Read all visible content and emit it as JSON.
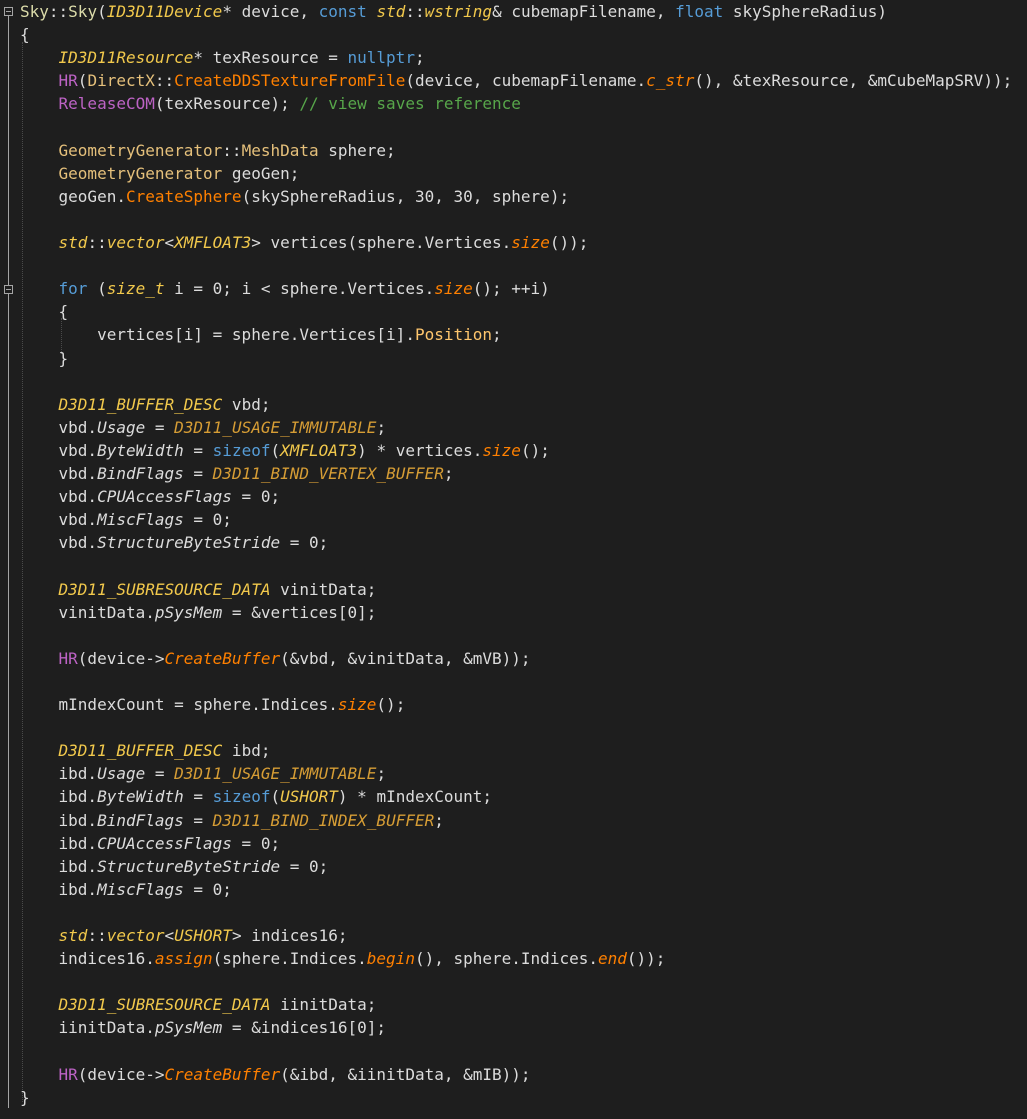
{
  "editor": {
    "lines": [
      [
        [
          "fn",
          "Sky"
        ],
        [
          "default",
          "::"
        ],
        [
          "fn",
          "Sky"
        ],
        [
          "default",
          "("
        ],
        [
          "type",
          "ID3D11Device"
        ],
        [
          "default",
          "* device, "
        ],
        [
          "keyword",
          "const"
        ],
        [
          "default",
          " "
        ],
        [
          "type",
          "std"
        ],
        [
          "default",
          "::"
        ],
        [
          "type",
          "wstring"
        ],
        [
          "default",
          "& cubemapFilename, "
        ],
        [
          "keyword",
          "float"
        ],
        [
          "default",
          " skySphereRadius)"
        ]
      ],
      [
        [
          "default",
          "{"
        ]
      ],
      [
        [
          "default",
          "    "
        ],
        [
          "type",
          "ID3D11Resource"
        ],
        [
          "default",
          "* texResource = "
        ],
        [
          "keyword",
          "nullptr"
        ],
        [
          "default",
          ";"
        ]
      ],
      [
        [
          "default",
          "    "
        ],
        [
          "macro",
          "HR"
        ],
        [
          "default",
          "("
        ],
        [
          "class",
          "DirectX"
        ],
        [
          "default",
          "::"
        ],
        [
          "method",
          "CreateDDSTextureFromFile"
        ],
        [
          "default",
          "(device, cubemapFilename."
        ],
        [
          "method-i",
          "c_str"
        ],
        [
          "default",
          "(), &texResource, &mCubeMapSRV));"
        ]
      ],
      [
        [
          "default",
          "    "
        ],
        [
          "macro",
          "ReleaseCOM"
        ],
        [
          "default",
          "(texResource); "
        ],
        [
          "comment",
          "// view saves reference"
        ]
      ],
      [
        [
          "default",
          ""
        ]
      ],
      [
        [
          "default",
          "    "
        ],
        [
          "class",
          "GeometryGenerator"
        ],
        [
          "default",
          "::"
        ],
        [
          "class",
          "MeshData"
        ],
        [
          "default",
          " sphere;"
        ]
      ],
      [
        [
          "default",
          "    "
        ],
        [
          "class",
          "GeometryGenerator"
        ],
        [
          "default",
          " geoGen;"
        ]
      ],
      [
        [
          "default",
          "    geoGen."
        ],
        [
          "method",
          "CreateSphere"
        ],
        [
          "default",
          "(skySphereRadius, 30, 30, sphere);"
        ]
      ],
      [
        [
          "default",
          ""
        ]
      ],
      [
        [
          "default",
          "    "
        ],
        [
          "type",
          "std"
        ],
        [
          "default",
          "::"
        ],
        [
          "type",
          "vector"
        ],
        [
          "default",
          "<"
        ],
        [
          "type",
          "XMFLOAT3"
        ],
        [
          "default",
          "> vertices(sphere.Vertices."
        ],
        [
          "method-i",
          "size"
        ],
        [
          "default",
          "());"
        ]
      ],
      [
        [
          "default",
          ""
        ]
      ],
      [
        [
          "default",
          "    "
        ],
        [
          "keyword",
          "for"
        ],
        [
          "default",
          " ("
        ],
        [
          "type",
          "size_t"
        ],
        [
          "default",
          " i = 0; i < sphere.Vertices."
        ],
        [
          "method-i",
          "size"
        ],
        [
          "default",
          "(); ++i)"
        ]
      ],
      [
        [
          "default",
          "    {"
        ]
      ],
      [
        [
          "default",
          "        vertices[i] = sphere.Vertices[i]."
        ],
        [
          "prop",
          "Position"
        ],
        [
          "default",
          ";"
        ]
      ],
      [
        [
          "default",
          "    }"
        ]
      ],
      [
        [
          "default",
          ""
        ]
      ],
      [
        [
          "default",
          "    "
        ],
        [
          "type",
          "D3D11_BUFFER_DESC"
        ],
        [
          "default",
          " vbd;"
        ]
      ],
      [
        [
          "default",
          "    vbd."
        ],
        [
          "member",
          "Usage"
        ],
        [
          "default",
          " = "
        ],
        [
          "enumv",
          "D3D11_USAGE_IMMUTABLE"
        ],
        [
          "default",
          ";"
        ]
      ],
      [
        [
          "default",
          "    vbd."
        ],
        [
          "member",
          "ByteWidth"
        ],
        [
          "default",
          " = "
        ],
        [
          "keyword",
          "sizeof"
        ],
        [
          "default",
          "("
        ],
        [
          "type",
          "XMFLOAT3"
        ],
        [
          "default",
          ") * vertices."
        ],
        [
          "method-i",
          "size"
        ],
        [
          "default",
          "();"
        ]
      ],
      [
        [
          "default",
          "    vbd."
        ],
        [
          "member",
          "BindFlags"
        ],
        [
          "default",
          " = "
        ],
        [
          "enumv",
          "D3D11_BIND_VERTEX_BUFFER"
        ],
        [
          "default",
          ";"
        ]
      ],
      [
        [
          "default",
          "    vbd."
        ],
        [
          "member",
          "CPUAccessFlags"
        ],
        [
          "default",
          " = 0;"
        ]
      ],
      [
        [
          "default",
          "    vbd."
        ],
        [
          "member",
          "MiscFlags"
        ],
        [
          "default",
          " = 0;"
        ]
      ],
      [
        [
          "default",
          "    vbd."
        ],
        [
          "member",
          "StructureByteStride"
        ],
        [
          "default",
          " = 0;"
        ]
      ],
      [
        [
          "default",
          ""
        ]
      ],
      [
        [
          "default",
          "    "
        ],
        [
          "type",
          "D3D11_SUBRESOURCE_DATA"
        ],
        [
          "default",
          " vinitData;"
        ]
      ],
      [
        [
          "default",
          "    vinitData."
        ],
        [
          "member",
          "pSysMem"
        ],
        [
          "default",
          " = &vertices[0];"
        ]
      ],
      [
        [
          "default",
          ""
        ]
      ],
      [
        [
          "default",
          "    "
        ],
        [
          "macro",
          "HR"
        ],
        [
          "default",
          "(device->"
        ],
        [
          "method-i",
          "CreateBuffer"
        ],
        [
          "default",
          "(&vbd, &vinitData, &mVB));"
        ]
      ],
      [
        [
          "default",
          ""
        ]
      ],
      [
        [
          "default",
          "    mIndexCount = sphere.Indices."
        ],
        [
          "method-i",
          "size"
        ],
        [
          "default",
          "();"
        ]
      ],
      [
        [
          "default",
          ""
        ]
      ],
      [
        [
          "default",
          "    "
        ],
        [
          "type",
          "D3D11_BUFFER_DESC"
        ],
        [
          "default",
          " ibd;"
        ]
      ],
      [
        [
          "default",
          "    ibd."
        ],
        [
          "member",
          "Usage"
        ],
        [
          "default",
          " = "
        ],
        [
          "enumv",
          "D3D11_USAGE_IMMUTABLE"
        ],
        [
          "default",
          ";"
        ]
      ],
      [
        [
          "default",
          "    ibd."
        ],
        [
          "member",
          "ByteWidth"
        ],
        [
          "default",
          " = "
        ],
        [
          "keyword",
          "sizeof"
        ],
        [
          "default",
          "("
        ],
        [
          "type",
          "USHORT"
        ],
        [
          "default",
          ") * mIndexCount;"
        ]
      ],
      [
        [
          "default",
          "    ibd."
        ],
        [
          "member",
          "BindFlags"
        ],
        [
          "default",
          " = "
        ],
        [
          "enumv",
          "D3D11_BIND_INDEX_BUFFER"
        ],
        [
          "default",
          ";"
        ]
      ],
      [
        [
          "default",
          "    ibd."
        ],
        [
          "member",
          "CPUAccessFlags"
        ],
        [
          "default",
          " = 0;"
        ]
      ],
      [
        [
          "default",
          "    ibd."
        ],
        [
          "member",
          "StructureByteStride"
        ],
        [
          "default",
          " = 0;"
        ]
      ],
      [
        [
          "default",
          "    ibd."
        ],
        [
          "member",
          "MiscFlags"
        ],
        [
          "default",
          " = 0;"
        ]
      ],
      [
        [
          "default",
          ""
        ]
      ],
      [
        [
          "default",
          "    "
        ],
        [
          "type",
          "std"
        ],
        [
          "default",
          "::"
        ],
        [
          "type",
          "vector"
        ],
        [
          "default",
          "<"
        ],
        [
          "type",
          "USHORT"
        ],
        [
          "default",
          "> indices16;"
        ]
      ],
      [
        [
          "default",
          "    indices16."
        ],
        [
          "method-i",
          "assign"
        ],
        [
          "default",
          "(sphere.Indices."
        ],
        [
          "method-i",
          "begin"
        ],
        [
          "default",
          "(), sphere.Indices."
        ],
        [
          "method-i",
          "end"
        ],
        [
          "default",
          "());"
        ]
      ],
      [
        [
          "default",
          ""
        ]
      ],
      [
        [
          "default",
          "    "
        ],
        [
          "type",
          "D3D11_SUBRESOURCE_DATA"
        ],
        [
          "default",
          " iinitData;"
        ]
      ],
      [
        [
          "default",
          "    iinitData."
        ],
        [
          "member",
          "pSysMem"
        ],
        [
          "default",
          " = &indices16[0];"
        ]
      ],
      [
        [
          "default",
          ""
        ]
      ],
      [
        [
          "default",
          "    "
        ],
        [
          "macro",
          "HR"
        ],
        [
          "default",
          "(device->"
        ],
        [
          "method-i",
          "CreateBuffer"
        ],
        [
          "default",
          "(&ibd, &iinitData, &mIB));"
        ]
      ],
      [
        [
          "default",
          "}"
        ]
      ]
    ]
  }
}
